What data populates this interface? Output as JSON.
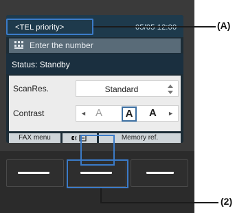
{
  "screen": {
    "mode_label": "<TEL priority>",
    "datetime": "05/05 12:00",
    "prompt": "Enter the number",
    "status": "Status: Standby"
  },
  "settings": {
    "scan_res_label": "ScanRes.",
    "scan_res_value": "Standard",
    "contrast_label": "Contrast",
    "contrast_options": [
      "A",
      "A",
      "A"
    ],
    "contrast_selected": "A"
  },
  "function_bar": {
    "left": "FAX menu",
    "middle": "",
    "right": "Memory ref."
  },
  "callouts": {
    "a": "(A)",
    "two": "(2)"
  },
  "colors": {
    "callout": "#3b7bc8",
    "lcd_background": "#1c2c36"
  }
}
